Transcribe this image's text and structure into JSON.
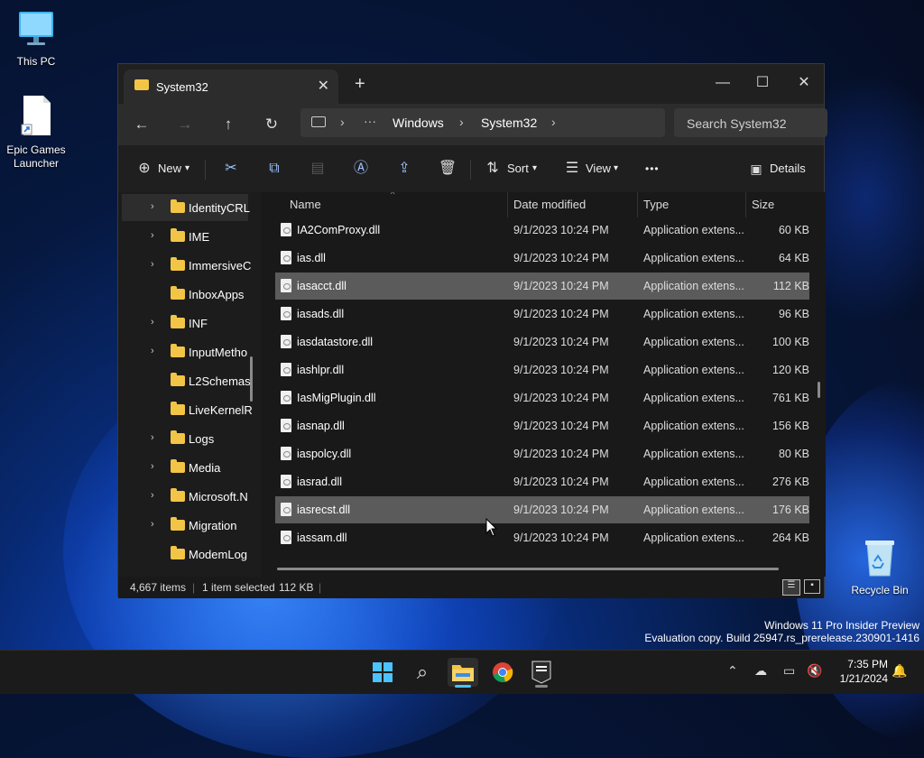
{
  "desktop": {
    "icons": [
      {
        "label": "This PC"
      },
      {
        "label": "Epic Games Launcher"
      },
      {
        "label": "Recycle Bin"
      }
    ],
    "watermark_line1": "Windows 11 Pro Insider Preview",
    "watermark_line2": "Evaluation copy. Build 25947.rs_prerelease.230901-1416"
  },
  "window": {
    "tab_title": "System32",
    "breadcrumb": [
      "Windows",
      "System32"
    ],
    "search_placeholder": "Search System32",
    "toolbar": {
      "new_label": "New",
      "sort_label": "Sort",
      "view_label": "View",
      "more_label": "•••",
      "details_label": "Details"
    },
    "nav_items": [
      {
        "name": "IdentityCRL",
        "expandable": true
      },
      {
        "name": "IME",
        "expandable": true
      },
      {
        "name": "ImmersiveC",
        "expandable": true
      },
      {
        "name": "InboxApps",
        "expandable": false
      },
      {
        "name": "INF",
        "expandable": true
      },
      {
        "name": "InputMetho",
        "expandable": true
      },
      {
        "name": "L2Schemas",
        "expandable": false
      },
      {
        "name": "LiveKernelR",
        "expandable": false
      },
      {
        "name": "Logs",
        "expandable": true
      },
      {
        "name": "Media",
        "expandable": true
      },
      {
        "name": "Microsoft.N",
        "expandable": true
      },
      {
        "name": "Migration",
        "expandable": true
      },
      {
        "name": "ModemLog",
        "expandable": false
      }
    ],
    "columns": {
      "name": "Name",
      "date": "Date modified",
      "type": "Type",
      "size": "Size"
    },
    "files": [
      {
        "name": "IA2ComProxy.dll",
        "date": "9/1/2023 10:24 PM",
        "type": "Application extens...",
        "size": "60 KB",
        "selected": false
      },
      {
        "name": "ias.dll",
        "date": "9/1/2023 10:24 PM",
        "type": "Application extens...",
        "size": "64 KB",
        "selected": false
      },
      {
        "name": "iasacct.dll",
        "date": "9/1/2023 10:24 PM",
        "type": "Application extens...",
        "size": "112 KB",
        "selected": true
      },
      {
        "name": "iasads.dll",
        "date": "9/1/2023 10:24 PM",
        "type": "Application extens...",
        "size": "96 KB",
        "selected": false
      },
      {
        "name": "iasdatastore.dll",
        "date": "9/1/2023 10:24 PM",
        "type": "Application extens...",
        "size": "100 KB",
        "selected": false
      },
      {
        "name": "iashlpr.dll",
        "date": "9/1/2023 10:24 PM",
        "type": "Application extens...",
        "size": "120 KB",
        "selected": false
      },
      {
        "name": "IasMigPlugin.dll",
        "date": "9/1/2023 10:24 PM",
        "type": "Application extens...",
        "size": "761 KB",
        "selected": false
      },
      {
        "name": "iasnap.dll",
        "date": "9/1/2023 10:24 PM",
        "type": "Application extens...",
        "size": "156 KB",
        "selected": false
      },
      {
        "name": "iaspolcy.dll",
        "date": "9/1/2023 10:24 PM",
        "type": "Application extens...",
        "size": "80 KB",
        "selected": false
      },
      {
        "name": "iasrad.dll",
        "date": "9/1/2023 10:24 PM",
        "type": "Application extens...",
        "size": "276 KB",
        "selected": false
      },
      {
        "name": "iasrecst.dll",
        "date": "9/1/2023 10:24 PM",
        "type": "Application extens...",
        "size": "176 KB",
        "selected": false,
        "hover": true
      },
      {
        "name": "iassam.dll",
        "date": "9/1/2023 10:24 PM",
        "type": "Application extens...",
        "size": "264 KB",
        "selected": false
      }
    ],
    "status": {
      "items_count": "4,667 items",
      "selected": "1 item selected",
      "selected_size": "112 KB"
    }
  },
  "taskbar": {
    "time": "7:35 PM",
    "date": "1/21/2024"
  },
  "colors": {
    "accent": "#0078d4",
    "folder": "#f3c546",
    "selection": "#5b5b5b"
  }
}
